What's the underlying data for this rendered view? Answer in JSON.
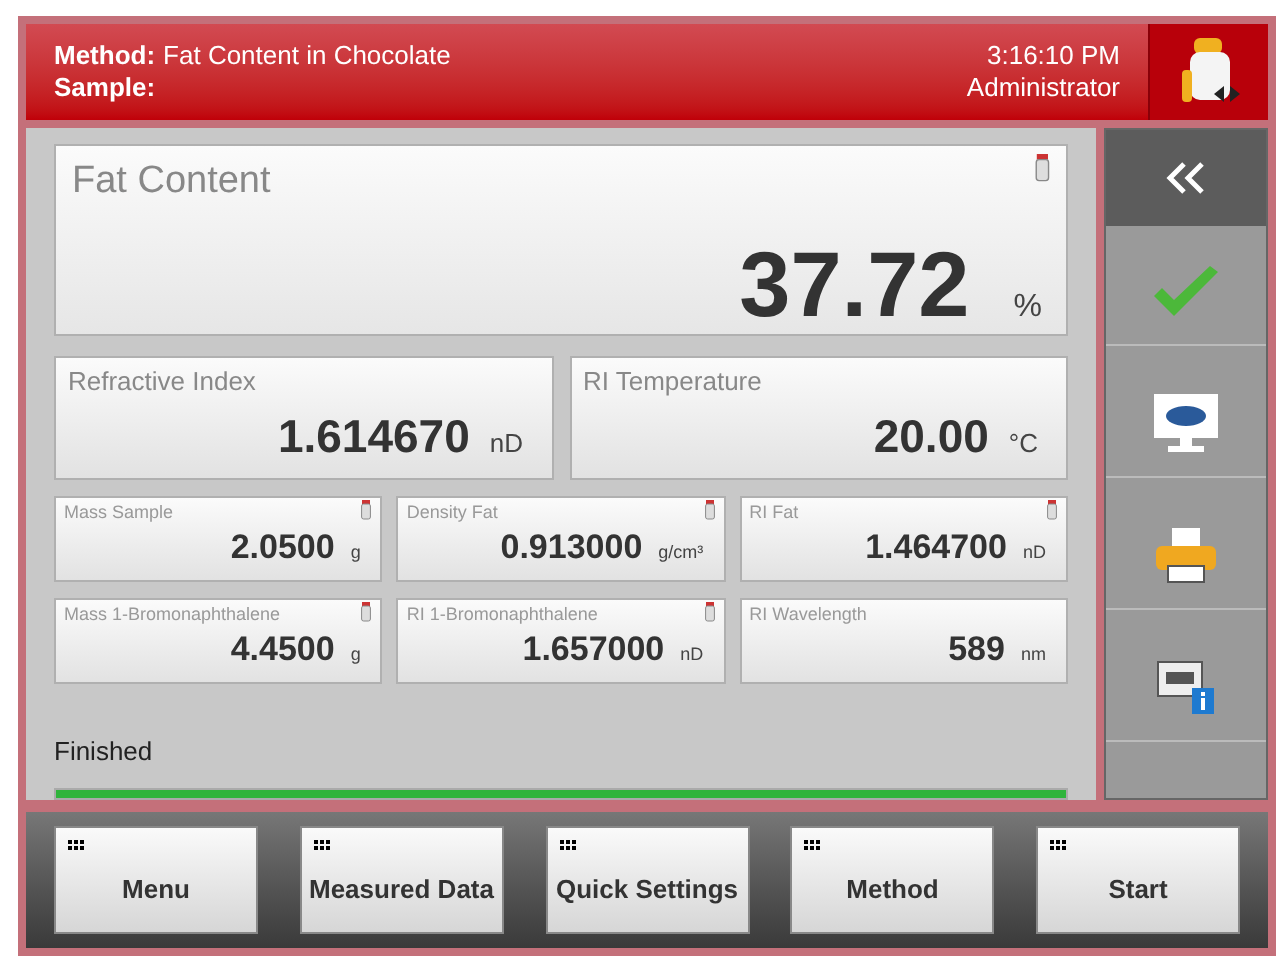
{
  "header": {
    "method_label": "Method:",
    "method": "Fat Content in Chocolate",
    "sample_label": "Sample:",
    "time": "3:16:10 PM",
    "user": "Administrator"
  },
  "main_result": {
    "label": "Fat Content",
    "value": "37.72",
    "unit": "%",
    "sample_linked": true
  },
  "results": [
    {
      "label": "Refractive Index",
      "value": "1.614670",
      "unit": "nD",
      "sample_linked": false
    },
    {
      "label": "RI Temperature",
      "value": "20.00",
      "unit": "°C",
      "sample_linked": false
    }
  ],
  "parameters": [
    {
      "label": "Mass Sample",
      "value": "2.0500",
      "unit": "g",
      "sample_linked": true
    },
    {
      "label": "Density Fat",
      "value": "0.913000",
      "unit": "g/cm³",
      "sample_linked": true
    },
    {
      "label": "RI Fat",
      "value": "1.464700",
      "unit": "nD",
      "sample_linked": true
    },
    {
      "label": "Mass 1-Bromonaphthalene",
      "value": "4.4500",
      "unit": "g",
      "sample_linked": true
    },
    {
      "label": "RI 1-Bromonaphthalene",
      "value": "1.657000",
      "unit": "nD",
      "sample_linked": true
    },
    {
      "label": "RI Wavelength",
      "value": "589",
      "unit": "nm",
      "sample_linked": false
    }
  ],
  "status": {
    "text": "Finished",
    "level": 1
  },
  "sidebar": [
    {
      "kind": "collapse",
      "selected": true
    },
    {
      "kind": "accept",
      "selected": false
    },
    {
      "kind": "display",
      "selected": false
    },
    {
      "kind": "print",
      "selected": false
    },
    {
      "kind": "info",
      "selected": false
    }
  ],
  "bottom_buttons": [
    "Menu",
    "Measured Data",
    "Quick Settings",
    "Method",
    "Start"
  ]
}
